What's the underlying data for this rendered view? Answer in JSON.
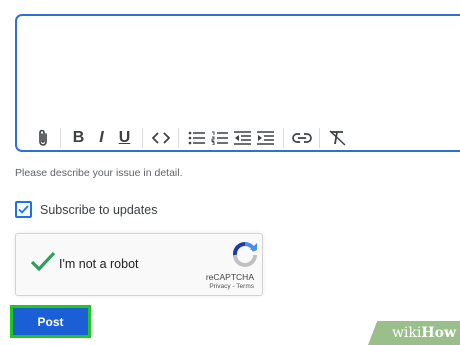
{
  "editor": {
    "value": "",
    "toolbar": [
      {
        "name": "attach-icon"
      },
      {
        "name": "bold-icon",
        "glyph": "B"
      },
      {
        "name": "italic-icon",
        "glyph": "I"
      },
      {
        "name": "underline-icon",
        "glyph": "U"
      },
      {
        "name": "code-icon"
      },
      {
        "name": "bulleted-list-icon"
      },
      {
        "name": "numbered-list-icon"
      },
      {
        "name": "indent-decrease-icon"
      },
      {
        "name": "indent-increase-icon"
      },
      {
        "name": "link-icon"
      },
      {
        "name": "clear-formatting-icon"
      }
    ]
  },
  "helper_text": "Please describe your issue in detail.",
  "subscribe": {
    "label": "Subscribe to updates",
    "checked": true
  },
  "captcha": {
    "label": "I'm not a robot",
    "checked": true,
    "brand": "reCAPTCHA",
    "links": "Privacy - Terms"
  },
  "post_button": {
    "label": "Post"
  },
  "watermark": {
    "prefix": "wiki",
    "suffix": "How"
  },
  "colors": {
    "editor_border": "#2f6fd9",
    "checkbox_accent": "#1a73e8",
    "captcha_check": "#2e9e5b",
    "post_button": "#1a5fd6",
    "post_highlight": "#1ec81e"
  }
}
